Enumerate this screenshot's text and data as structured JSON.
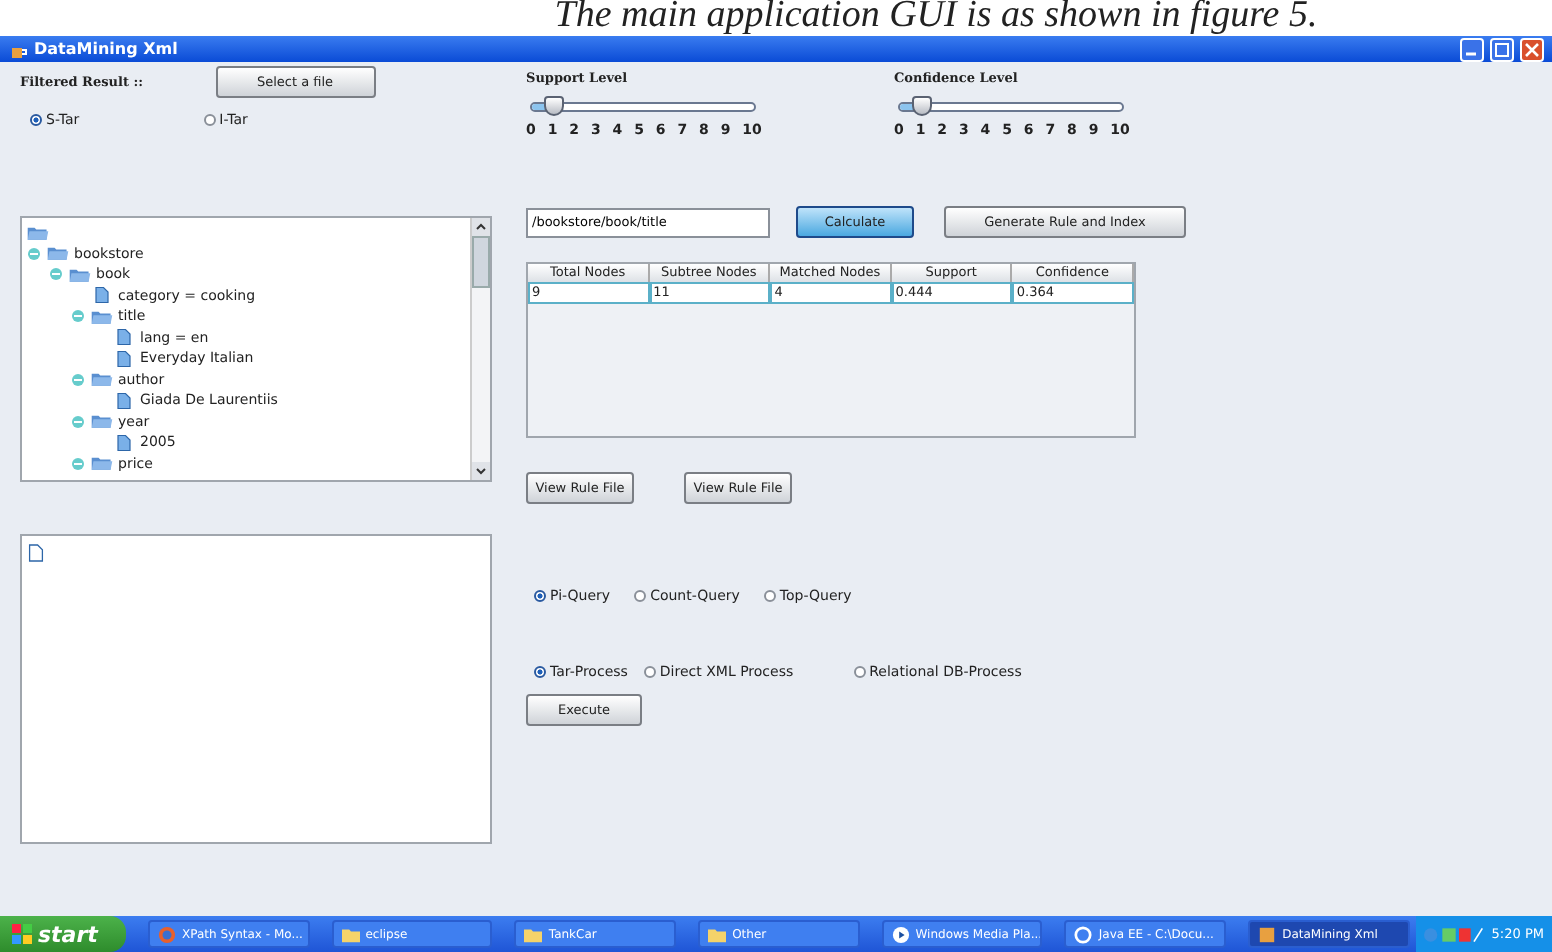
{
  "caption": "The main application GUI is as shown in figure 5.",
  "window": {
    "title": "DataMining Xml"
  },
  "filtered_label": "Filtered Result ::",
  "select_button": "Select a file",
  "tar_options": [
    {
      "label": "S-Tar",
      "selected": true
    },
    {
      "label": "I-Tar",
      "selected": false
    }
  ],
  "sliders": [
    {
      "label": "Support Level",
      "level": 0.1,
      "ticks": [
        "0",
        "1",
        "2",
        "3",
        "4",
        "5",
        "6",
        "7",
        "8",
        "9",
        "10"
      ]
    },
    {
      "label": "Confidence Level",
      "level": 0.1,
      "ticks": [
        "0",
        "1",
        "2",
        "3",
        "4",
        "5",
        "6",
        "7",
        "8",
        "9",
        "10"
      ]
    }
  ],
  "tree": [
    {
      "kind": "folder",
      "children": [
        {
          "label": "bookstore",
          "kind": "folder",
          "expanded": true,
          "children": [
            {
              "label": "book",
              "kind": "folder",
              "expanded": true,
              "children": [
                {
                  "label": "category = cooking",
                  "kind": "file"
                },
                {
                  "label": "title",
                  "kind": "folder",
                  "expanded": true,
                  "children": [
                    {
                      "label": "lang = en",
                      "kind": "file"
                    },
                    {
                      "label": "Everyday Italian",
                      "kind": "file"
                    }
                  ]
                },
                {
                  "label": "author",
                  "kind": "folder",
                  "expanded": true,
                  "children": [
                    {
                      "label": "Giada De Laurentiis",
                      "kind": "file"
                    }
                  ]
                },
                {
                  "label": "year",
                  "kind": "folder",
                  "expanded": true,
                  "children": [
                    {
                      "label": "2005",
                      "kind": "file"
                    }
                  ]
                },
                {
                  "label": "price",
                  "kind": "folder",
                  "expanded": true
                }
              ]
            }
          ]
        }
      ]
    }
  ],
  "xpath_field": {
    "value": "/bookstore/book/title"
  },
  "calculate_button": "Calculate",
  "generate_button": "Generate Rule and Index",
  "table": {
    "columns": [
      "Total Nodes",
      "Subtree Nodes",
      "Matched Nodes",
      "Support",
      "Confidence"
    ],
    "rows": [
      {
        "cells": [
          "9",
          "11",
          "4",
          "0.444",
          "0.364"
        ],
        "selected": true
      }
    ]
  },
  "view_buttons": [
    "View Rule File",
    "View Rule File"
  ],
  "query_options": [
    {
      "label": "Pi-Query",
      "selected": true
    },
    {
      "label": "Count-Query",
      "selected": false
    },
    {
      "label": "Top-Query",
      "selected": false
    }
  ],
  "process_options": [
    {
      "label": "Tar-Process",
      "selected": true
    },
    {
      "label": "Direct XML Process",
      "selected": false
    },
    {
      "label": "Relational DB-Process",
      "selected": false
    }
  ],
  "execute_button": "Execute",
  "taskbar": {
    "start": "start",
    "items": [
      {
        "label": "XPath Syntax - Mo...",
        "kind": "browser",
        "selected": false
      },
      {
        "label": "eclipse",
        "kind": "folder",
        "selected": false
      },
      {
        "label": "TankCar",
        "kind": "folder",
        "selected": false
      },
      {
        "label": "Other",
        "kind": "folder",
        "selected": false
      },
      {
        "label": "Windows Media Pla...",
        "kind": "media",
        "selected": false
      },
      {
        "label": "Java EE - C:\\Docu...",
        "kind": "app",
        "selected": false
      },
      {
        "label": "DataMining Xml",
        "kind": "java",
        "selected": true
      }
    ],
    "time": "5:20 PM"
  }
}
